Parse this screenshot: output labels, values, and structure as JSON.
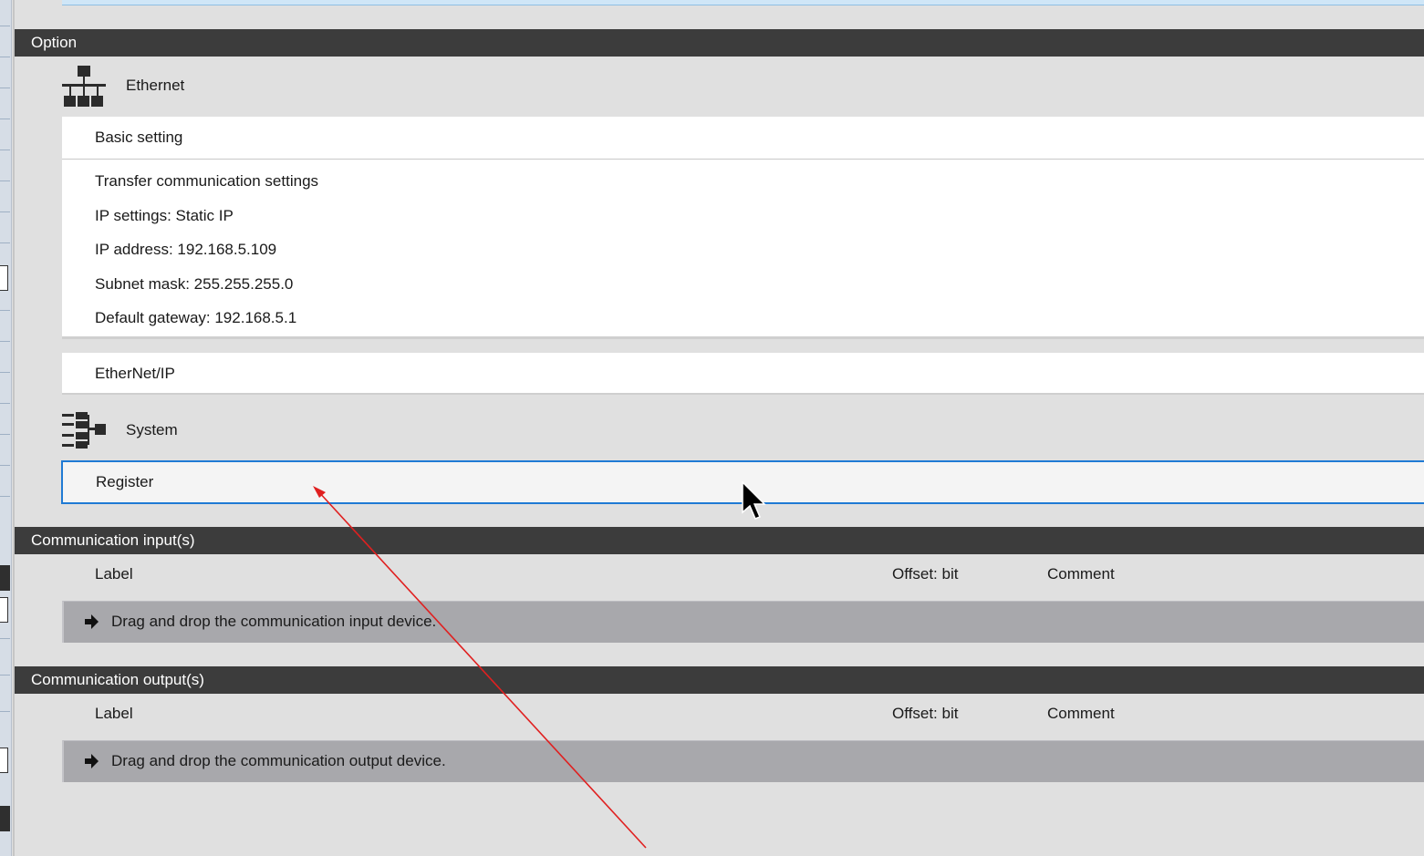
{
  "option": {
    "header": "Option",
    "ethernet": {
      "icon": "network-icon",
      "label": "Ethernet",
      "basic_setting": "Basic setting",
      "details": [
        "Transfer communication settings",
        "IP settings: Static IP",
        "IP address: 192.168.5.109",
        "Subnet mask: 255.255.255.0",
        "Default gateway: 192.168.5.1"
      ],
      "ethernet_ip": "EtherNet/IP"
    },
    "system": {
      "icon": "system-tree-icon",
      "label": "System",
      "register": "Register"
    }
  },
  "comm_inputs": {
    "header": "Communication input(s)",
    "columns": {
      "label": "Label",
      "offset": "Offset: bit",
      "comment": "Comment"
    },
    "drop_hint": "Drag and drop the communication input device."
  },
  "comm_outputs": {
    "header": "Communication output(s)",
    "columns": {
      "label": "Label",
      "offset": "Offset: bit",
      "comment": "Comment"
    },
    "drop_hint": "Drag and drop the communication output device."
  },
  "colors": {
    "header_bg": "#3c3c3c",
    "panel_bg": "#e0e0e0",
    "selection_border": "#1f7ad4",
    "drop_zone_bg": "#a8a8ac",
    "annotation_arrow": "#e02020"
  }
}
